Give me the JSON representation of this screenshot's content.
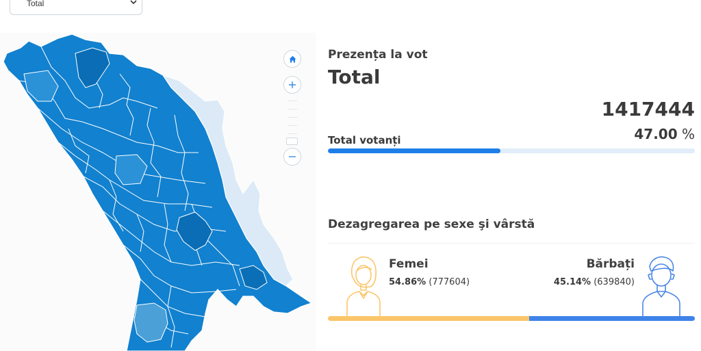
{
  "filter": {
    "selected": "Total"
  },
  "map": {
    "controls": {
      "home": "home-icon",
      "zoom_in": "plus-icon",
      "zoom_out": "minus-icon"
    },
    "colors": {
      "dark": "#0a6db5",
      "mid": "#1281cf",
      "light": "#2b92d8",
      "pale": "#4ba0d8",
      "outside": "#dbeaf6"
    }
  },
  "turnout": {
    "section_label": "Prezența la vot",
    "region": "Total",
    "count": "1417444",
    "percent_value": "47.00",
    "percent_sign": "%",
    "bar_label": "Total votanți",
    "bar_fraction": 0.47,
    "bar_color": "#1e7ee8"
  },
  "gender": {
    "section_label": "Dezagregarea pe sexe şi vârstă",
    "female": {
      "label": "Femei",
      "pct": "54.86%",
      "count": "(777604)",
      "fraction": 0.5486,
      "color": "#fbc66a",
      "icon": "female-icon"
    },
    "male": {
      "label": "Bărbați",
      "pct": "45.14%",
      "count": "(639840)",
      "fraction": 0.4514,
      "color": "#3f83e9",
      "icon": "male-icon"
    }
  }
}
